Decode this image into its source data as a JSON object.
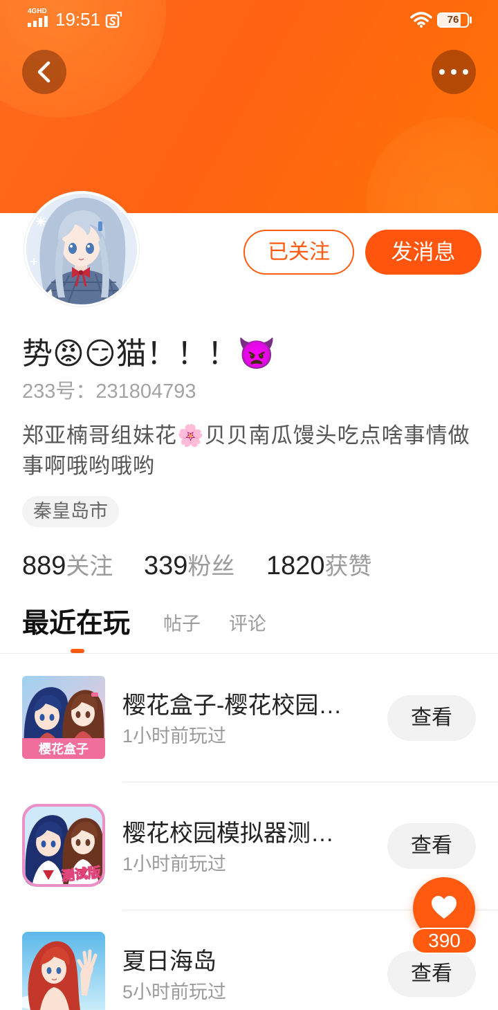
{
  "status_bar": {
    "network_label": "4GHD",
    "time": "19:51",
    "battery_level": "76",
    "icons": [
      "signal-icon",
      "notification-icon",
      "wifi-icon",
      "battery-icon"
    ]
  },
  "header": {
    "back_icon": "chevron-left-icon",
    "more_icon": "more-dots-icon"
  },
  "profile": {
    "avatar": "anime-girl-avatar",
    "follow_button": "已关注",
    "message_button": "发消息",
    "name": "势😡😏猫！！！👿",
    "account_id": "233号：231804793",
    "bio": "郑亚楠哥组妹花🌸贝贝南瓜馒头吃点啥事情做事啊哦哟哦哟",
    "location": "秦皇岛市",
    "stats": [
      {
        "count": "889",
        "label": "关注"
      },
      {
        "count": "339",
        "label": "粉丝"
      },
      {
        "count": "1820",
        "label": "获赞"
      }
    ]
  },
  "tabs": [
    {
      "label": "最近在玩",
      "active": true
    },
    {
      "label": "帖子",
      "active": false
    },
    {
      "label": "评论",
      "active": false
    }
  ],
  "recent_games": [
    {
      "title": "樱花盒子-樱花校园…",
      "last_played": "1小时前玩过",
      "action": "查看",
      "icon": "sakura-box-game-icon",
      "icon_text": "樱花盒子"
    },
    {
      "title": "樱花校园模拟器测…",
      "last_played": "1小时前玩过",
      "action": "查看",
      "icon": "sakura-school-test-game-icon",
      "icon_text": "测试版"
    },
    {
      "title": "夏日海岛",
      "last_played": "5小时前玩过",
      "action": "查看",
      "icon": "summer-island-game-icon"
    }
  ],
  "like_button": {
    "icon": "heart-icon",
    "count": "390"
  },
  "colors": {
    "accent": "#ff5a10",
    "header_gradient": [
      "#ff6a1e",
      "#ff7308"
    ],
    "muted_text": "#9b9b9b",
    "chip_background": "#f3f3f3",
    "button_background": "#f2f2f2"
  }
}
